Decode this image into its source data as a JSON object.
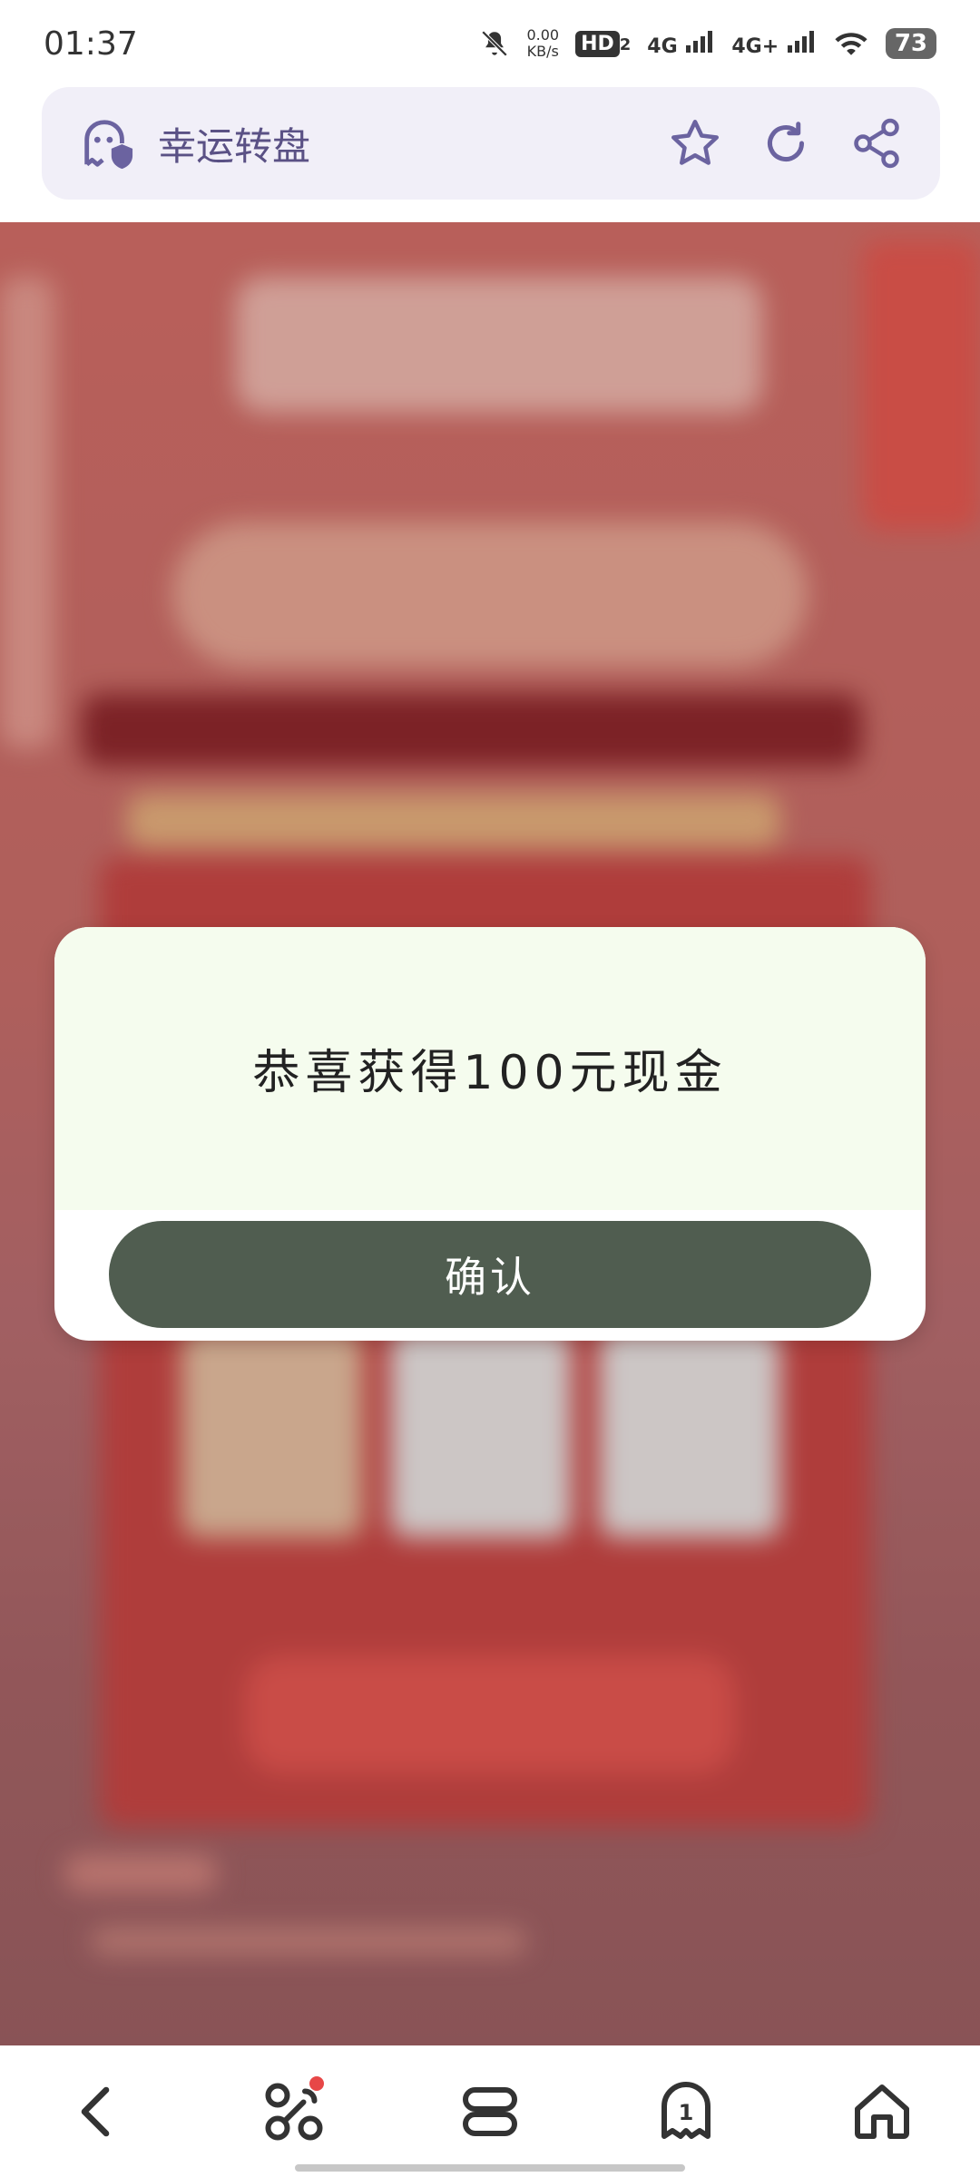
{
  "status_bar": {
    "time": "01:37",
    "speed_value": "0.00",
    "speed_unit": "KB/s",
    "hd": "HD",
    "hd_sub": "2",
    "net1": "4G",
    "net2": "4G+",
    "battery": "73"
  },
  "address_bar": {
    "title": "幸运转盘",
    "icons": [
      "ghost-shield-icon",
      "star-icon",
      "refresh-icon",
      "share-icon"
    ]
  },
  "dialog": {
    "message": "恭喜获得100元现金",
    "confirm_label": "确认"
  },
  "bottom_nav": {
    "tab_count": "1",
    "icons": [
      "back-icon",
      "apps-icon",
      "menu-icon",
      "tabs-icon",
      "home-icon"
    ]
  },
  "colors": {
    "accent": "#5a5185",
    "dialog_button": "#505d50",
    "dialog_top": "#f5fcee",
    "page_bg": "#c96a65"
  }
}
